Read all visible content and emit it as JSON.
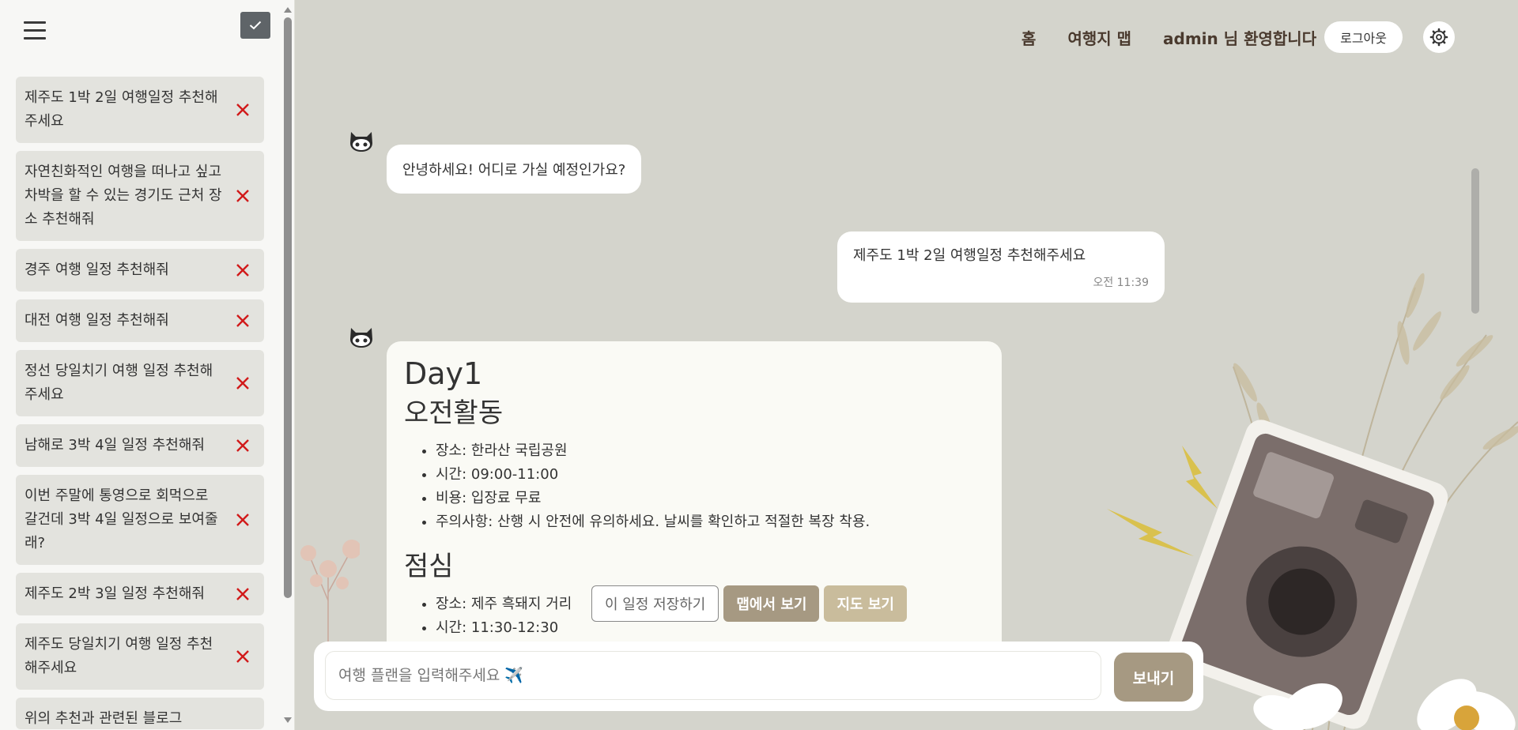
{
  "sidebar": {
    "history": [
      {
        "text": "제주도 1박 2일 여행일정 추천해주세요"
      },
      {
        "text": "자연친화적인 여행을 떠나고 싶고 차박을 할 수 있는 경기도 근처 장소 추천해줘"
      },
      {
        "text": "경주 여행 일정 추천해줘"
      },
      {
        "text": "대전 여행 일정 추천해줘"
      },
      {
        "text": "정선 당일치기 여행 일정 추천해주세요"
      },
      {
        "text": "남해로 3박 4일 일정 추천해줘"
      },
      {
        "text": "이번 주말에 통영으로 회먹으로 갈건데 3박 4일 일정으로 보여줄래?"
      },
      {
        "text": "제주도 2박 3일 일정 추천해줘"
      },
      {
        "text": "제주도 당일치기 여행 일정 추천해주세요"
      },
      {
        "text": "위의 추천과 관련된 블로그"
      }
    ],
    "delete_icon": "close-icon",
    "colors": {
      "delete": "#d11a1a",
      "check_button": "#5f6468"
    }
  },
  "nav": {
    "home": "홈",
    "map": "여행지 맵",
    "welcome": "admin 님 환영합니다",
    "logout": "로그아웃"
  },
  "chat": {
    "greeting": "안녕하세요! 어디로 가실 예정인가요?",
    "user_message": "제주도 1박 2일 여행일정 추천해주세요",
    "user_time": "오전 11:39",
    "plan": {
      "day": "Day1",
      "morning_title": "오전활동",
      "morning": [
        "장소: 한라산 국립공원",
        "시간: 09:00-11:00",
        "비용: 입장료 무료",
        "주의사항: 산행 시 안전에 유의하세요. 날씨를 확인하고 적절한 복장 착용."
      ],
      "lunch_title": "점심",
      "lunch": [
        "장소: 제주 흑돼지 거리",
        "시간: 11:30-12:30"
      ]
    },
    "actions": {
      "save": "이 일정 저장하기",
      "map_view": "맵에서 보기",
      "map_show": "지도 보기"
    }
  },
  "input": {
    "placeholder": "여행 플랜을 입력해주세요 ✈️",
    "send": "보내기"
  },
  "colors": {
    "background": "#d4d4cc",
    "accent": "#a69982",
    "accent_light": "#c9bc9c",
    "nav_text": "#4a3a2e"
  }
}
